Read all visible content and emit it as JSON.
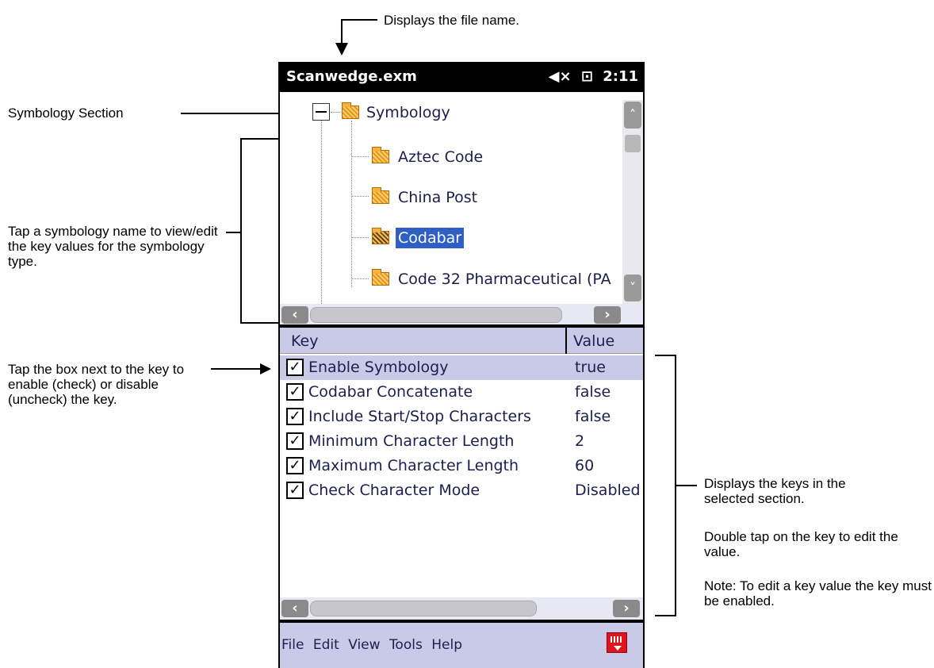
{
  "annotations": {
    "file_name": "Displays the file name.",
    "symbology_section": "Symbology Section",
    "tap_symbology": "Tap a symbology name to view/edit the key values for the symbology type.",
    "tap_box": "Tap the box next to the key to enable (check) or disable (uncheck) the key.",
    "displays_keys": "Displays the keys in the selected section.",
    "double_tap": "Double tap on the key to edit the value.",
    "note": "Note: To edit a key value the key must be enabled."
  },
  "status_bar": {
    "title": "Scanwedge.exm",
    "volume_icon": "speaker-muted-icon",
    "battery_icon": "battery-charging-icon",
    "time": "2:11"
  },
  "tree": {
    "root": {
      "label": "Symbology",
      "icon": "folder-icon",
      "expanded": true
    },
    "children": [
      {
        "label": "Aztec Code",
        "icon": "folder-icon"
      },
      {
        "label": "China Post",
        "icon": "folder-icon"
      },
      {
        "label": "Codabar",
        "icon": "folder-open-icon",
        "selected": true
      },
      {
        "label": "Code 32 Pharmaceutical (PA",
        "icon": "folder-icon"
      }
    ]
  },
  "key_list": {
    "header_key": "Key",
    "header_value": "Value",
    "rows": [
      {
        "key": "Enable Symbology",
        "value": "true",
        "checked": true,
        "highlighted": true
      },
      {
        "key": "Codabar Concatenate",
        "value": "false",
        "checked": true
      },
      {
        "key": "Include Start/Stop Characters",
        "value": "false",
        "checked": true
      },
      {
        "key": "Minimum Character Length",
        "value": "2",
        "checked": true
      },
      {
        "key": "Maximum Character Length",
        "value": "60",
        "checked": true
      },
      {
        "key": "Check Character Mode",
        "value": "Disabled",
        "checked": true
      }
    ]
  },
  "menu": {
    "items": [
      "File",
      "Edit",
      "View",
      "Tools",
      "Help"
    ],
    "keyboard_icon": "keyboard-icon"
  },
  "colors": {
    "selection": "#2d5fc4",
    "header_bg": "#c9c9e8",
    "text": "#1a1f4d"
  }
}
